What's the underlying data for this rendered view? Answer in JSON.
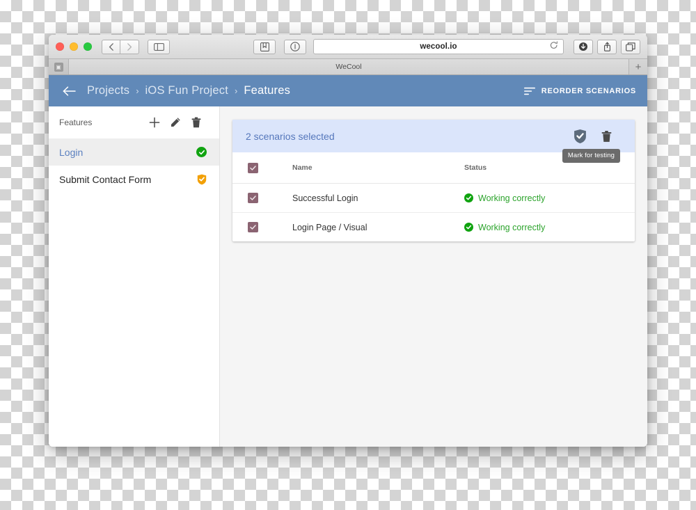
{
  "browser": {
    "url": "wecool.io",
    "tab_title": "WeCool",
    "favicon_glyph": "▣",
    "nav_back_icon": "‹",
    "nav_forward_icon": "›",
    "sidebar_toggle_icon": "sidebar-icon",
    "bookmarks_icon": "book-icon",
    "reader_icon": "info-icon",
    "reload_icon": "↻",
    "download_icon": "download-icon",
    "share_icon": "share-icon",
    "tabs_icon": "tabs-icon",
    "new_tab_icon": "+"
  },
  "header": {
    "back_label": "←",
    "breadcrumbs": [
      {
        "label": "Projects",
        "current": false
      },
      {
        "label": "iOS Fun Project",
        "current": false
      },
      {
        "label": "Features",
        "current": true
      }
    ],
    "separator": "›",
    "reorder_label": "REORDER SCENARIOS",
    "accent_color": "#6189b8"
  },
  "sidebar": {
    "title": "Features",
    "actions": [
      {
        "name": "add-feature-button",
        "icon": "plus-icon"
      },
      {
        "name": "edit-feature-button",
        "icon": "pencil-icon"
      },
      {
        "name": "delete-feature-button",
        "icon": "trash-icon"
      }
    ],
    "items": [
      {
        "label": "Login",
        "selected": true,
        "status": "working",
        "status_color": "#10a310"
      },
      {
        "label": "Submit Contact Form",
        "selected": false,
        "status": "testing",
        "status_color": "#f2a007"
      }
    ]
  },
  "selection_bar": {
    "text": "2 scenarios selected",
    "background": "#dbe5fb",
    "text_color": "#5577bb",
    "mark_icon": "shield-check-icon",
    "delete_icon": "trash-icon",
    "tooltip": "Mark for testing"
  },
  "table": {
    "columns": [
      "Name",
      "Status"
    ],
    "rows": [
      {
        "checked": true,
        "name": "Successful Login",
        "status": "Working correctly",
        "status_color": "#2ba32b"
      },
      {
        "checked": true,
        "name": "Login Page / Visual",
        "status": "Working correctly",
        "status_color": "#2ba32b"
      }
    ],
    "checkbox_color": "#8b6472"
  }
}
